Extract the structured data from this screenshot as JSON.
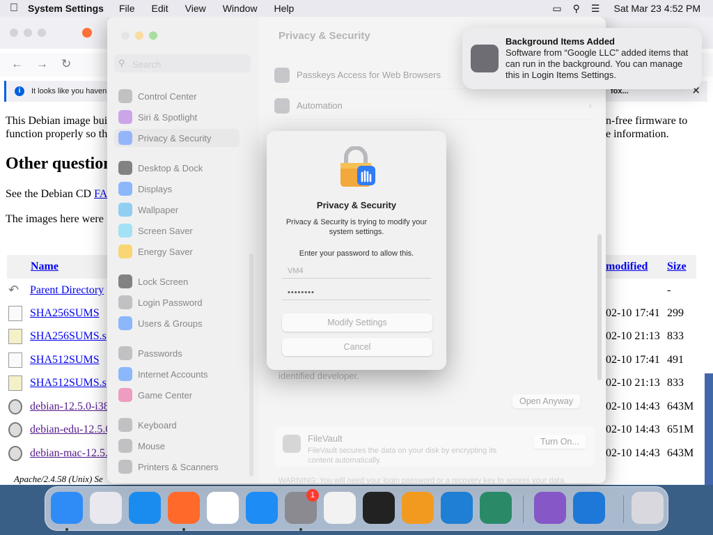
{
  "menubar": {
    "app_name": "System Settings",
    "menus": [
      "File",
      "Edit",
      "View",
      "Window",
      "Help"
    ],
    "clock": "Sat Mar 23  4:52 PM"
  },
  "browser": {
    "notice": "It looks like you haven",
    "notice_link": "fox...",
    "para1_left": "This Debian image bui\nfunction properly so th",
    "para1_right": "n-free firmware to\ne information.",
    "heading": "Other question",
    "para2_text": "See the Debian CD ",
    "para2_link": "FA",
    "para3": "The images here were",
    "columns": {
      "name": "Name",
      "modified": "modified",
      "size": "Size"
    },
    "rows": [
      {
        "name": "Parent Directory",
        "date": "",
        "size": "-",
        "icon": "back-icon"
      },
      {
        "name": "SHA256SUMS",
        "date": "02-10 17:41",
        "size": "299",
        "icon": "text-file-icon"
      },
      {
        "name": "SHA256SUMS.s",
        "date": "02-10 21:13",
        "size": "833",
        "icon": "signature-file-icon"
      },
      {
        "name": "SHA512SUMS",
        "date": "02-10 17:41",
        "size": "491",
        "icon": "text-file-icon"
      },
      {
        "name": "SHA512SUMS.s",
        "date": "02-10 21:13",
        "size": "833",
        "icon": "signature-file-icon"
      },
      {
        "name": "debian-12.5.0-i38",
        "date": "02-10 14:43",
        "size": "643M",
        "icon": "disc-icon"
      },
      {
        "name": "debian-edu-12.5.0",
        "date": "02-10 14:43",
        "size": "651M",
        "icon": "disc-icon"
      },
      {
        "name": "debian-mac-12.5.",
        "date": "02-10 14:43",
        "size": "643M",
        "icon": "disc-icon"
      }
    ],
    "address": "Apache/2.4.58 (Unix) Se"
  },
  "settings": {
    "title": "Privacy & Security",
    "search_placeholder": "Search",
    "sidebar": [
      {
        "label": "Control Center",
        "color": "#8e8e93"
      },
      {
        "label": "Siri & Spotlight",
        "color": "#a35bd6"
      },
      {
        "label": "Privacy & Security",
        "color": "#3d7bf5",
        "active": true
      },
      {
        "label": "Desktop & Dock",
        "color": "#1c1c1e"
      },
      {
        "label": "Displays",
        "color": "#2f7cf6"
      },
      {
        "label": "Wallpaper",
        "color": "#35a7e8"
      },
      {
        "label": "Screen Saver",
        "color": "#5ac8ef"
      },
      {
        "label": "Energy Saver",
        "color": "#f4b400"
      },
      {
        "label": "Lock Screen",
        "color": "#1c1c1e"
      },
      {
        "label": "Login Password",
        "color": "#8e8e93"
      },
      {
        "label": "Users & Groups",
        "color": "#2f7cf6"
      },
      {
        "label": "Passwords",
        "color": "#8e8e93"
      },
      {
        "label": "Internet Accounts",
        "color": "#2f7cf6"
      },
      {
        "label": "Game Center",
        "color": "#e04b8a"
      },
      {
        "label": "Keyboard",
        "color": "#8e8e93"
      },
      {
        "label": "Mouse",
        "color": "#8e8e93"
      },
      {
        "label": "Printers & Scanners",
        "color": "#8e8e93"
      }
    ],
    "content_rows": [
      "Passkeys Access for Web Browsers",
      "Automation"
    ],
    "content_text": "it is not from an\nidentified developer.",
    "open_anyway": "Open Anyway",
    "filevault_title": "FileVault",
    "filevault_desc": "FileVault secures the data on your disk by encrypting its content automatically.",
    "turn_on": "Turn On...",
    "warning": "WARNING: You will need your login password or a recovery key to access your data."
  },
  "dialog": {
    "title": "Privacy & Security",
    "message": "Privacy & Security is trying to modify your system settings.",
    "prompt": "Enter your password to allow this.",
    "username": "VM4",
    "password_mask": "••••••••",
    "modify_button": "Modify Settings",
    "cancel_button": "Cancel"
  },
  "notification": {
    "title": "Background Items Added",
    "body": "Software from “Google LLC” added items that can run in the background. You can manage this in Login Items Settings."
  },
  "dock": {
    "badge": "1",
    "apps": [
      {
        "name": "finder",
        "color": "#2f8cf6"
      },
      {
        "name": "launchpad",
        "color": "#e8e8ee"
      },
      {
        "name": "safari",
        "color": "#1a8cf0"
      },
      {
        "name": "firefox",
        "color": "#ff6a2b"
      },
      {
        "name": "chrome",
        "color": "#ffffff"
      },
      {
        "name": "app-store",
        "color": "#1d8cf5"
      },
      {
        "name": "system-settings",
        "color": "#8a8a90"
      },
      {
        "name": "textedit",
        "color": "#f2f2f2"
      },
      {
        "name": "terminal",
        "color": "#222222"
      },
      {
        "name": "garageband",
        "color": "#f29a1f"
      },
      {
        "name": "vscode",
        "color": "#1e7fd4"
      },
      {
        "name": "activity-monitor",
        "color": "#2a8a68"
      },
      {
        "name": "visual-studio",
        "color": "#8657c7"
      },
      {
        "name": "onedrive",
        "color": "#1e78d7"
      },
      {
        "name": "trash",
        "color": "#d8d8de"
      }
    ]
  }
}
